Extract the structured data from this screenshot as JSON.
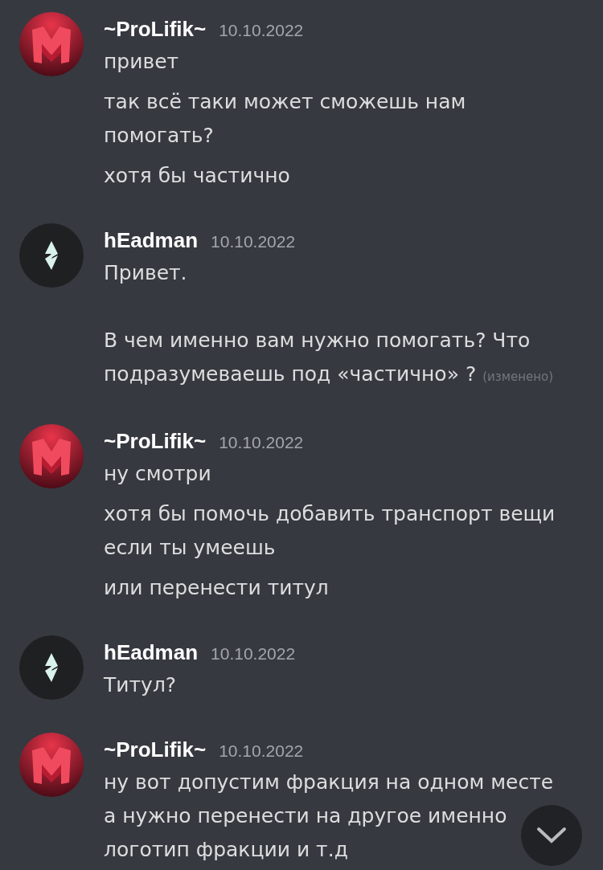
{
  "messages": [
    {
      "author": "~ProLifik~",
      "kind": "m-logo",
      "timestamp": "10.10.2022",
      "lines": [
        {
          "paragraphs": [
            [
              "привет"
            ]
          ]
        },
        {
          "paragraphs": [
            [
              "так всё таки может сможешь нам",
              "помогать?"
            ]
          ]
        },
        {
          "paragraphs": [
            [
              "хотя бы частично"
            ]
          ]
        }
      ]
    },
    {
      "author": "hEadman",
      "kind": "crystal",
      "timestamp": "10.10.2022",
      "lines": [
        {
          "paragraphs": [
            [
              "Привет."
            ],
            [
              "В чем именно вам нужно помогать? Что",
              "подразумеваешь под «частично» ?"
            ]
          ],
          "edited": "(изменено)"
        }
      ]
    },
    {
      "author": "~ProLifik~",
      "kind": "m-logo",
      "timestamp": "10.10.2022",
      "lines": [
        {
          "paragraphs": [
            [
              "ну смотри"
            ]
          ]
        },
        {
          "paragraphs": [
            [
              "хотя бы помочь добавить транспорт вещи",
              "если ты умеешь"
            ]
          ]
        },
        {
          "paragraphs": [
            [
              "или перенести титул"
            ]
          ]
        }
      ]
    },
    {
      "author": "hEadman",
      "kind": "crystal",
      "timestamp": "10.10.2022",
      "lines": [
        {
          "paragraphs": [
            [
              "Титул?"
            ]
          ]
        }
      ]
    },
    {
      "author": "~ProLifik~",
      "kind": "m-logo",
      "timestamp": "10.10.2022",
      "lines": [
        {
          "paragraphs": [
            [
              "ну вот допустим фракция на одном месте",
              "а нужно перенести на другое именно",
              "логотип фракции и т.д"
            ]
          ]
        }
      ]
    }
  ]
}
